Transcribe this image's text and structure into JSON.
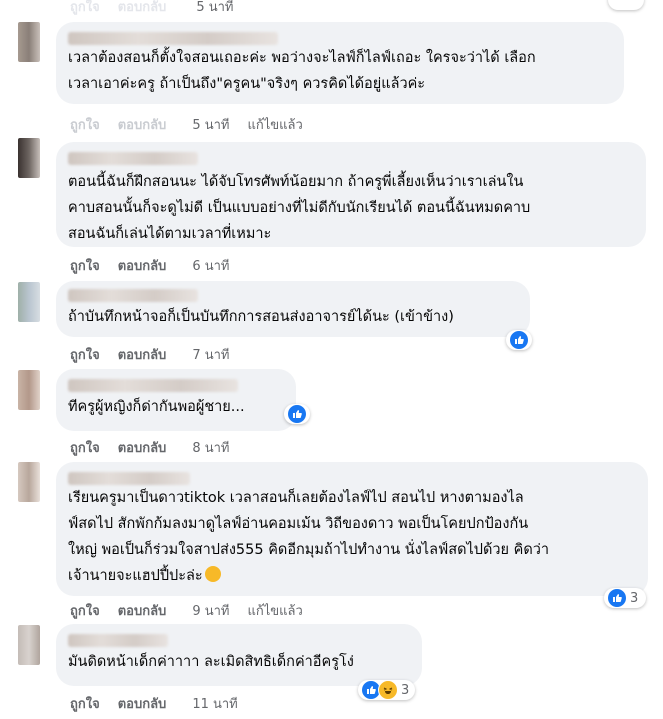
{
  "top": {
    "time": "5 นาที",
    "actions": [
      "ถูกใจ",
      "ตอบกลับ"
    ]
  },
  "comments": [
    {
      "text": "เวลาต้องสอนก็ตั้งใจสอนเถอะค่ะ พอว่างจะไลฟ์ก็ไลฟ์เถอะ ใครจะว่าได้ เลือก\nเวลาเอาค่ะครู ถ้าเป็นถึง\"ครูคน\"จริงๆ ควรคิดได้อยู่แล้วค่ะ",
      "like": "ถูกใจ",
      "reply": "ตอบกลับ",
      "time": "5 นาที",
      "edited": "แก้ไขแล้ว"
    },
    {
      "text": "ตอนนี้ฉันก็ฝึกสอนนะ ได้จับโทรศัพท์น้อยมาก ถ้าครูพี่เลี้ยงเห็นว่าเราเล่นใน\nคาบสอนนั้นก็จะดูไม่ดี เป็นแบบอย่างที่ไม่ดีกับนักเรียนได้ ตอนนี้ฉันหมดคาบ\nสอนฉันก็เล่นได้ตามเวลาที่เหมาะ",
      "like": "ถูกใจ",
      "reply": "ตอบกลับ",
      "time": "6 นาที"
    },
    {
      "text": "ถ้าบันทึกหน้าจอก็เป็นบันทึกการสอนส่งอาจารย์ได้นะ (เข้าข้าง)",
      "like": "ถูกใจ",
      "reply": "ตอบกลับ",
      "time": "7 นาที"
    },
    {
      "text": "ทีครูผู้หญิงก็ด่ากันพอผู้ชาย...",
      "like": "ถูกใจ",
      "reply": "ตอบกลับ",
      "time": "8 นาที"
    },
    {
      "text": "เรียนครูมาเป็นดาวtiktok เวลาสอนก็เลยต้องไลฟ์ไป สอนไป หางตามองไล\nฟ์สดไป สักพักก้มลงมาดูไลฟ์อ่านคอมเม้น วิถีของดาว พอเป็นโคยปกป้องกัน\nใหญ่ พอเป็นก็ร่วมใจสาปส่ง555 คิดอีกมุมถ้าไปทำงาน นั่งไลฟ์สดไปด้วย คิดว่า\nเจ้านายจะแฮปปี้ปะล่ะ",
      "like": "ถูกใจ",
      "reply": "ตอบกลับ",
      "time": "9 นาที",
      "edited": "แก้ไขแล้ว",
      "reaction_count": "3"
    },
    {
      "text": "มันดิดหน้าเด็กค่าาาา ละเมิดสิทธิเด็กค่าอีครูโง่",
      "like": "ถูกใจ",
      "reply": "ตอบกลับ",
      "time": "11 นาที",
      "reaction_count": "3"
    }
  ],
  "colors": {
    "like_blue": "#1877f2",
    "haha_yellow": "#f7b928",
    "bubble": "#f0f2f5",
    "meta": "#65676b"
  }
}
